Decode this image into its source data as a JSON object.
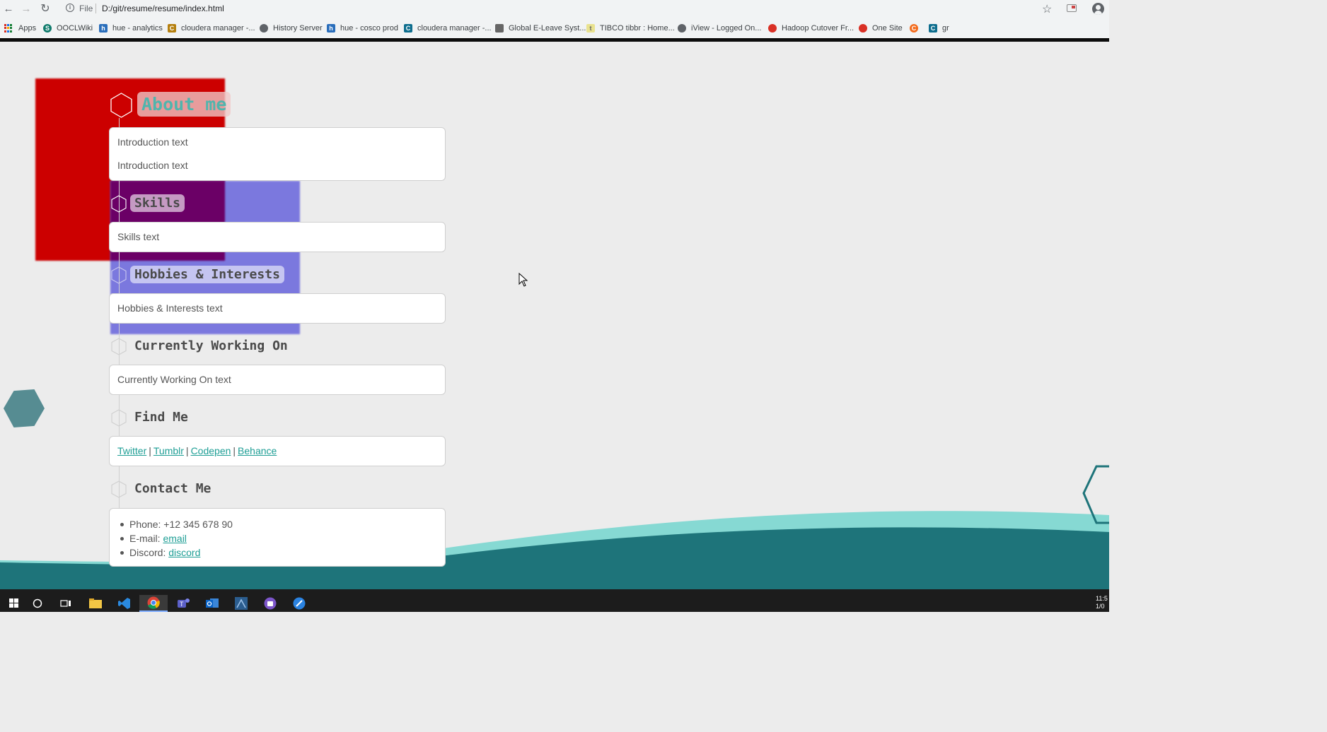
{
  "browser": {
    "file_label": "File",
    "url": "D:/git/resume/resume/index.html",
    "bookmarks": [
      {
        "label": "Apps",
        "icon": "apps-grid-icon"
      },
      {
        "label": "OOCLWiki",
        "icon": "sharepoint-icon"
      },
      {
        "label": "hue - analytics",
        "icon": "hue-icon"
      },
      {
        "label": "cloudera manager -...",
        "icon": "cloudera-icon"
      },
      {
        "label": "History Server",
        "icon": "globe-icon"
      },
      {
        "label": "hue - cosco prod",
        "icon": "hue-icon"
      },
      {
        "label": "cloudera manager -...",
        "icon": "cloudera-icon"
      },
      {
        "label": "Global E-Leave Syst...",
        "icon": "eleave-icon"
      },
      {
        "label": "TIBCO tibbr : Home...",
        "icon": "tibbr-icon"
      },
      {
        "label": "iView - Logged On...",
        "icon": "globe-icon"
      },
      {
        "label": "Hadoop Cutover Fr...",
        "icon": "hadoop-icon"
      },
      {
        "label": "One Site",
        "icon": "onesite-icon"
      },
      {
        "label": "",
        "icon": "c-orange-icon"
      },
      {
        "label": "gr",
        "icon": "cloudera-icon"
      }
    ]
  },
  "sections": {
    "about": {
      "title": "About me",
      "lines": [
        "Introduction text",
        "Introduction text"
      ]
    },
    "skills": {
      "title": "Skills",
      "text": "Skills text"
    },
    "hobbies": {
      "title": "Hobbies & Interests",
      "text": "Hobbies & Interests text"
    },
    "working": {
      "title": "Currently Working On",
      "text": "Currently Working On text"
    },
    "findme": {
      "title": "Find Me",
      "links": [
        "Twitter",
        "Tumblr",
        "Codepen",
        "Behance"
      ],
      "separator": "|"
    },
    "contact": {
      "title": "Contact Me",
      "items": [
        {
          "label": "Phone: +12 345 678 90",
          "link": ""
        },
        {
          "label": "E-mail: ",
          "link": "email"
        },
        {
          "label": "Discord: ",
          "link": "discord"
        }
      ]
    }
  },
  "taskbar": {
    "clock_time": "11:5",
    "clock_date": "1/0",
    "apps": [
      "start-icon",
      "search-icon",
      "task-view-icon",
      "file-explorer-icon",
      "vscode-icon",
      "chrome-icon",
      "teams-icon",
      "outlook-icon",
      "app-icon",
      "app-icon",
      "app-icon"
    ]
  },
  "colors": {
    "accent": "#1e9e95",
    "wave_dark": "#1e747a",
    "wave_light": "#86d9d3",
    "red_square": "#cc0000",
    "blue_square": "#7b78de"
  }
}
